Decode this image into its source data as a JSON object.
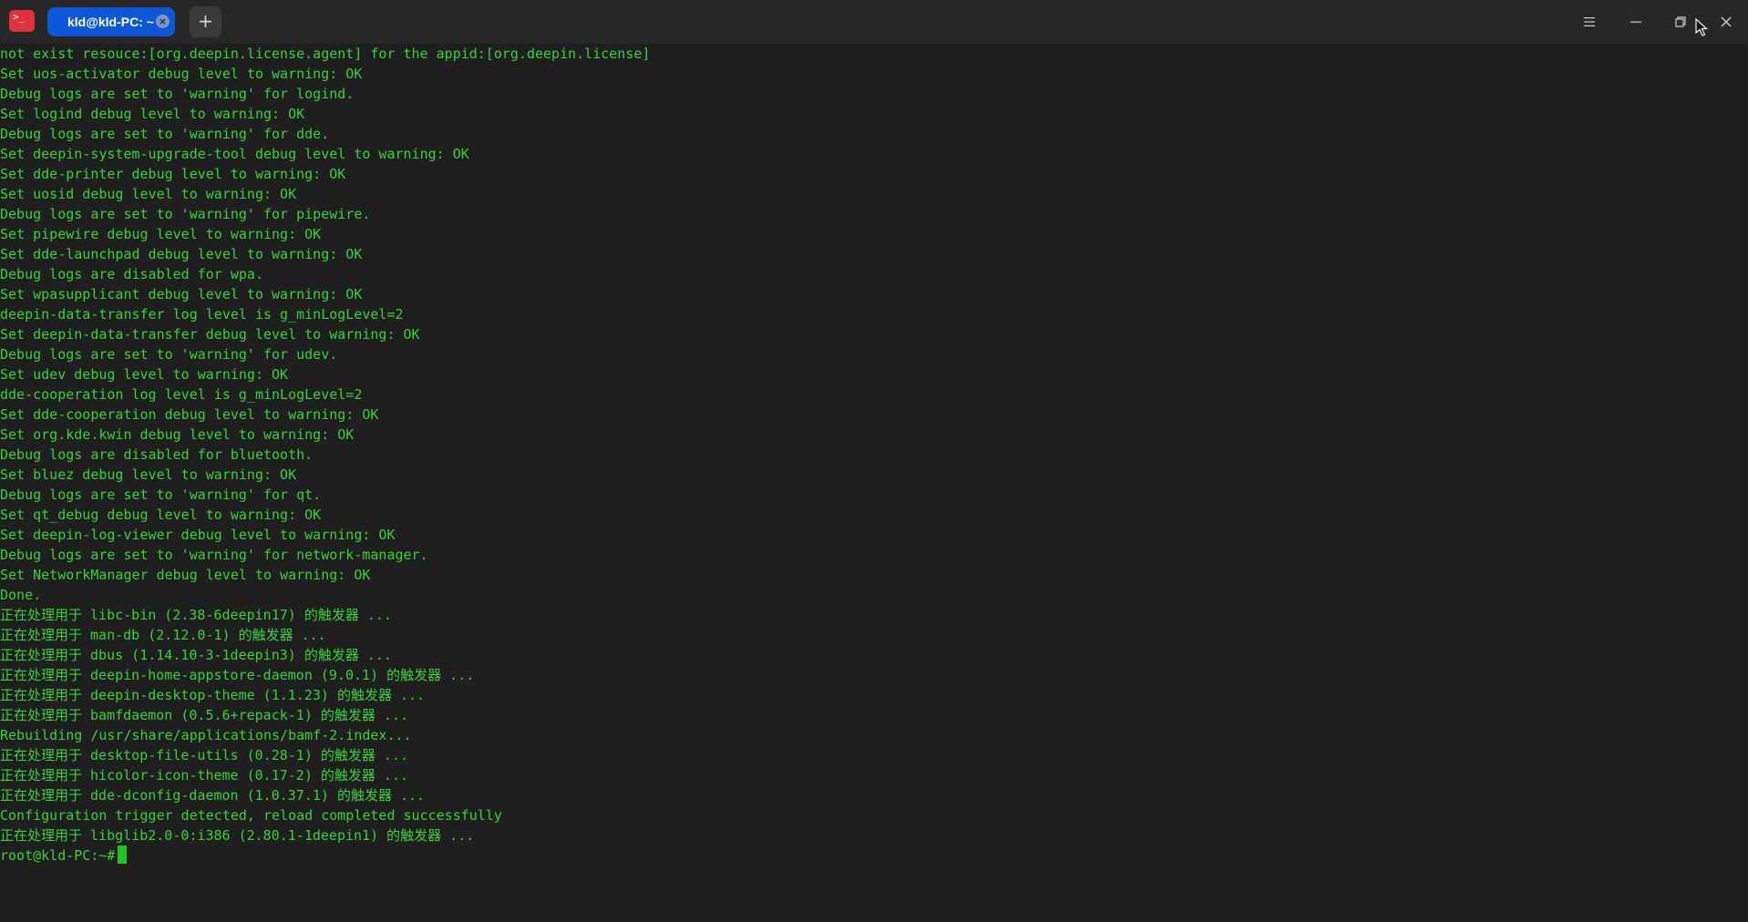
{
  "titlebar": {
    "app_icon_glyph": ">_",
    "tab_label": "kld@kld-PC: ~",
    "tab_close_glyph": "×",
    "new_tab_glyph": "+",
    "menu_icon": "hamburger-menu-icon",
    "minimize_icon": "minimize-icon",
    "maximize_icon": "restore-icon",
    "close_icon": "close-icon"
  },
  "terminal": {
    "lines": [
      "not exist resouce:[org.deepin.license.agent] for the appid:[org.deepin.license]",
      "Set uos-activator debug level to warning: OK",
      "Debug logs are set to 'warning' for logind.",
      "Set logind debug level to warning: OK",
      "Debug logs are set to 'warning' for dde.",
      "Set deepin-system-upgrade-tool debug level to warning: OK",
      "Set dde-printer debug level to warning: OK",
      "Set uosid debug level to warning: OK",
      "Debug logs are set to 'warning' for pipewire.",
      "Set pipewire debug level to warning: OK",
      "Set dde-launchpad debug level to warning: OK",
      "Debug logs are disabled for wpa.",
      "Set wpasupplicant debug level to warning: OK",
      "deepin-data-transfer log level is g_minLogLevel=2",
      "Set deepin-data-transfer debug level to warning: OK",
      "Debug logs are set to 'warning' for udev.",
      "Set udev debug level to warning: OK",
      "dde-cooperation log level is g_minLogLevel=2",
      "Set dde-cooperation debug level to warning: OK",
      "Set org.kde.kwin debug level to warning: OK",
      "Debug logs are disabled for bluetooth.",
      "Set bluez debug level to warning: OK",
      "Debug logs are set to 'warning' for qt.",
      "Set qt_debug debug level to warning: OK",
      "Set deepin-log-viewer debug level to warning: OK",
      "Debug logs are set to 'warning' for network-manager.",
      "Set NetworkManager debug level to warning: OK",
      "Done.",
      "正在处理用于 libc-bin (2.38-6deepin17) 的触发器 ...",
      "正在处理用于 man-db (2.12.0-1) 的触发器 ...",
      "正在处理用于 dbus (1.14.10-3-1deepin3) 的触发器 ...",
      "正在处理用于 deepin-home-appstore-daemon (9.0.1) 的触发器 ...",
      "正在处理用于 deepin-desktop-theme (1.1.23) 的触发器 ...",
      "正在处理用于 bamfdaemon (0.5.6+repack-1) 的触发器 ...",
      "Rebuilding /usr/share/applications/bamf-2.index...",
      "正在处理用于 desktop-file-utils (0.28-1) 的触发器 ...",
      "正在处理用于 hicolor-icon-theme (0.17-2) 的触发器 ...",
      "正在处理用于 dde-dconfig-daemon (1.0.37.1) 的触发器 ...",
      "Configuration trigger detected, reload completed successfully",
      "正在处理用于 libglib2.0-0:i386 (2.80.1-1deepin1) 的触发器 ..."
    ],
    "prompt": "root@kld-PC:~#"
  },
  "colors": {
    "terminal_text": "#3ad13a",
    "terminal_background": "#1f1f1f",
    "tab_active": "#0d57d9",
    "app_icon": "#e0313d"
  }
}
